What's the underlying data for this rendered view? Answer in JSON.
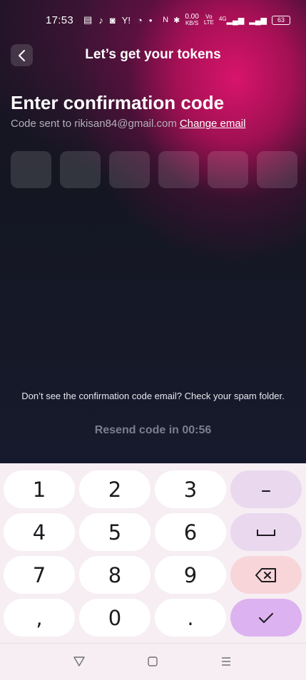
{
  "status_bar": {
    "time": "17:53",
    "net_speed_value": "0.00",
    "net_speed_unit": "KB/S",
    "volte_top": "Vo",
    "volte_bottom": "LTE",
    "net_type": "4G",
    "battery": "63"
  },
  "header": {
    "title": "Let’s get your tokens"
  },
  "main": {
    "title": "Enter confirmation code",
    "subtitle": "Code sent to rikisan84@gmail.com",
    "change_email": "Change email",
    "code_boxes": [
      "",
      "",
      "",
      "",
      "",
      ""
    ],
    "hint": "Don’t see the confirmation code email? Check your spam folder.",
    "resend": "Resend code in 00:56"
  },
  "keyboard": {
    "keys": [
      "1",
      "2",
      "3",
      "–",
      "4",
      "5",
      "6",
      "␣",
      "7",
      "8",
      "9",
      "⌫",
      ",",
      "0",
      ".",
      "✓"
    ]
  },
  "colors": {
    "accent_pink": "#e0146e",
    "background": "#131522",
    "keyboard_bg": "#f6eef3",
    "confirm_key": "#ddb2f0"
  }
}
